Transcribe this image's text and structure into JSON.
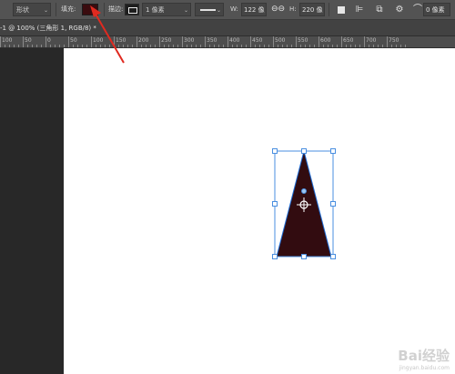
{
  "options_bar": {
    "mode_label": "形状",
    "fill_label": "填充:",
    "fill_color": "#3a0c0f",
    "stroke_label": "描边:",
    "stroke_width": "1 像素",
    "width_label": "W:",
    "width_value": "122 像",
    "height_label": "H:",
    "height_value": "220 像",
    "radius_value": "0 像素"
  },
  "tab": {
    "title": "-1 @ 100% (三角形 1, RGB/8) *"
  },
  "ruler": {
    "labels": [
      "100",
      "50",
      "0",
      "50",
      "100",
      "150",
      "200",
      "250",
      "300",
      "350",
      "400",
      "450",
      "500",
      "550",
      "600",
      "650",
      "700",
      "750"
    ]
  },
  "shape": {
    "name": "三角形 1",
    "fill": "#320c10",
    "path_color": "#1c6bd6",
    "handle_color": "#4a8fe0"
  },
  "annotation": {
    "arrow_color": "#e02a20"
  },
  "watermark": {
    "text": "Bai经验",
    "sub": "jingyan.baidu.com"
  }
}
